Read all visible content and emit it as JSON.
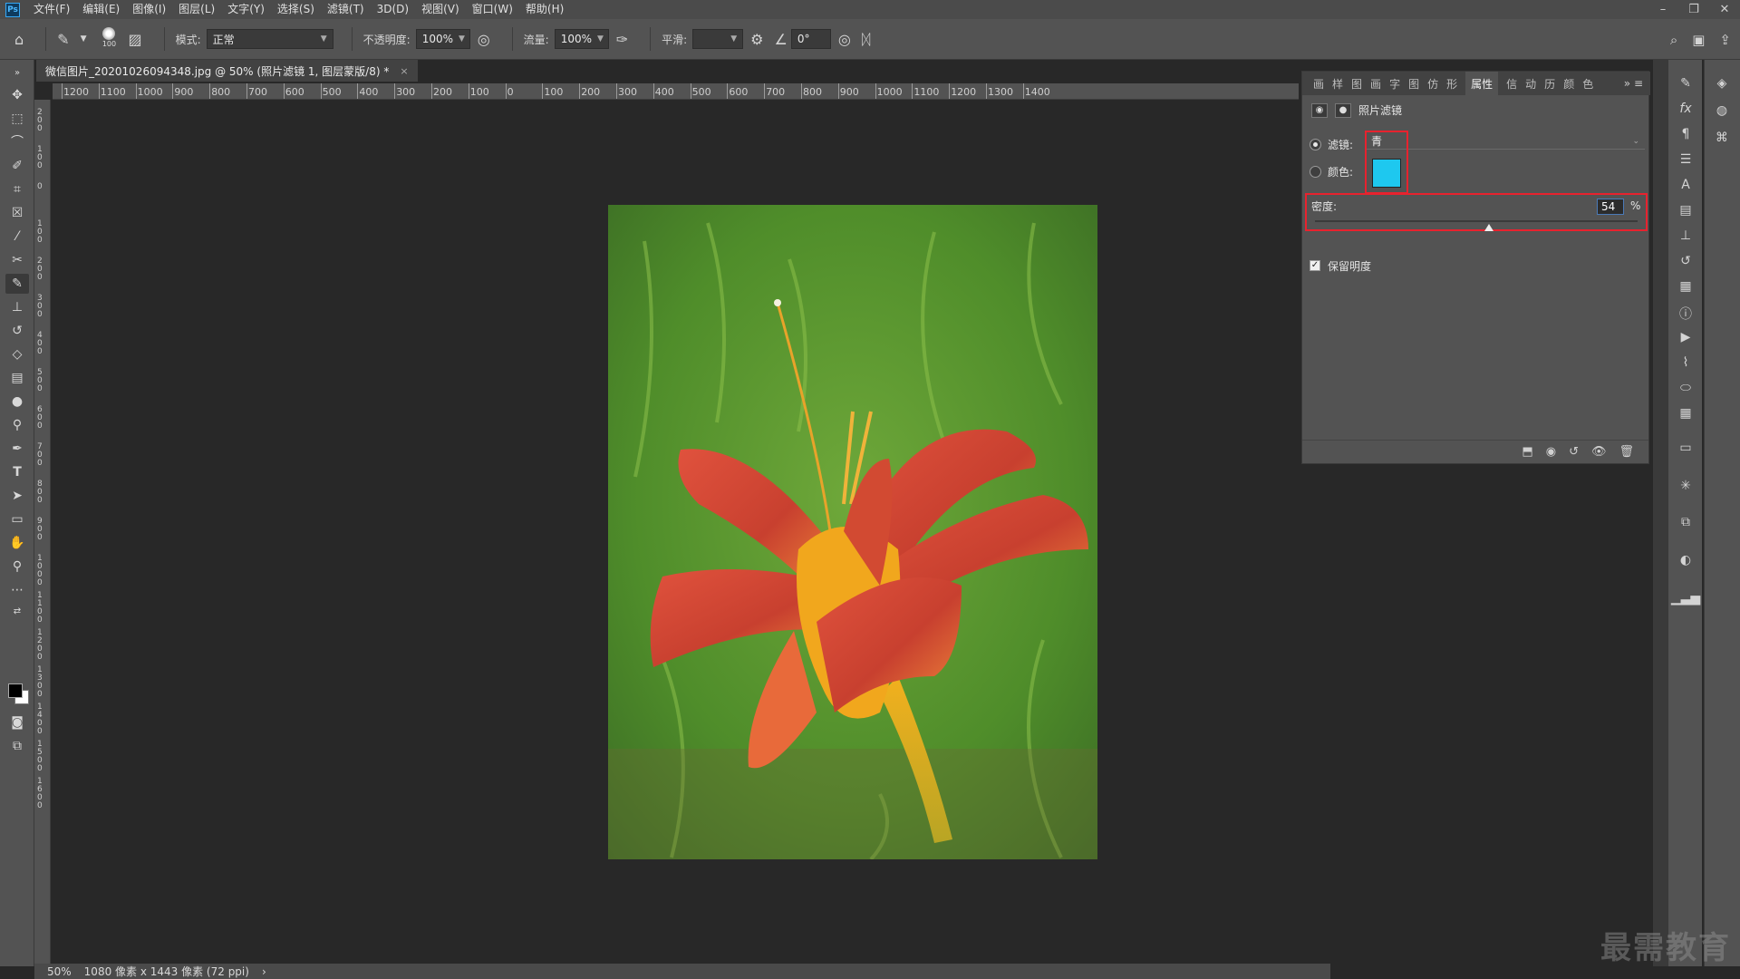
{
  "app": {
    "logo": "Ps",
    "menu": [
      "文件(F)",
      "编辑(E)",
      "图像(I)",
      "图层(L)",
      "文字(Y)",
      "选择(S)",
      "滤镜(T)",
      "3D(D)",
      "视图(V)",
      "窗口(W)",
      "帮助(H)"
    ],
    "window_controls": [
      "–",
      "❐",
      "✕"
    ]
  },
  "options_bar": {
    "brush_size": "100",
    "mode_label": "模式:",
    "mode_value": "正常",
    "opacity_label": "不透明度:",
    "opacity_value": "100%",
    "flow_label": "流量:",
    "flow_value": "100%",
    "smooth_label": "平滑:",
    "smooth_value": "",
    "angle_value": "0°"
  },
  "document": {
    "tab_title": "微信图片_20201026094348.jpg @ 50% (照片滤镜 1, 图层蒙版/8) *",
    "close": "×"
  },
  "rulers": {
    "top_labels": [
      "1200",
      "1100",
      "1000",
      "900",
      "800",
      "700",
      "600",
      "500",
      "400",
      "300",
      "200",
      "100",
      "0",
      "100",
      "200",
      "300",
      "400",
      "500",
      "600",
      "700",
      "800",
      "900",
      "1000",
      "1100",
      "1200",
      "1300",
      "1400"
    ],
    "left_labels": [
      "200",
      "100",
      "0",
      "100",
      "200",
      "300",
      "400",
      "500",
      "600",
      "700",
      "800",
      "900",
      "1000",
      "1100",
      "1200",
      "1300",
      "1400",
      "1500",
      "1600"
    ]
  },
  "status": {
    "zoom": "50%",
    "info": "1080 像素 x 1443 像素 (72 ppi)",
    "arrow": "›"
  },
  "properties": {
    "tabs": [
      "画",
      "样",
      "图",
      "画",
      "字",
      "图",
      "仿",
      "形",
      "属性",
      "信",
      "动",
      "历",
      "颜",
      "色"
    ],
    "header": "照片滤镜",
    "filter_label": "滤镜:",
    "filter_value": "青",
    "color_label": "颜色:",
    "color_hex": "#1ec8ef",
    "density_label": "密度:",
    "density_value": "54",
    "density_unit": "%",
    "density_level": 0.54,
    "preserve_label": "保留明度",
    "preserve_checked": true
  },
  "watermark": "最需教育"
}
